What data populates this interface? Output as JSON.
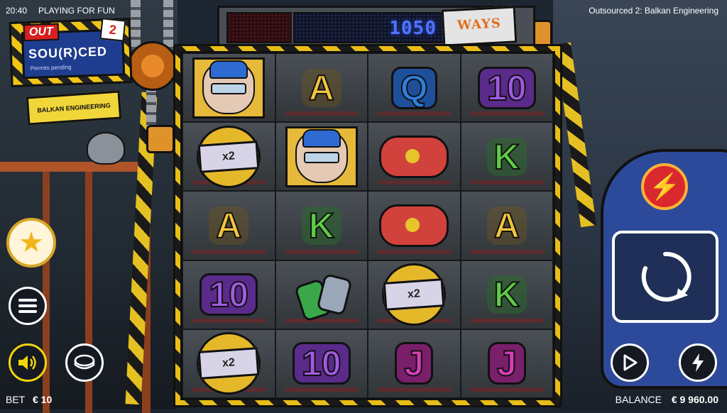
{
  "status_bar": {
    "clock": "20:40",
    "mode": "PLAYING FOR FUN",
    "game_title": "Outsourced 2: Balkan Engineering"
  },
  "logo": {
    "out": "OUT",
    "sourced": "SOU(R)CED",
    "permits": "Permits pending",
    "number": "2",
    "sign": "BALKAN ENGINEERING"
  },
  "win_display": {
    "ways_count": "1050",
    "ways_label": "WAYS"
  },
  "reels": [
    [
      "worker",
      "A",
      "Q",
      "10"
    ],
    [
      "x2",
      "worker",
      "gamepad",
      "K"
    ],
    [
      "A",
      "K",
      "gamepad",
      "A"
    ],
    [
      "10",
      "cans",
      "x2",
      "K"
    ],
    [
      "x2",
      "10",
      "J",
      "J"
    ]
  ],
  "bottom_bar": {
    "bet_label": "BET",
    "bet_value": "€ 10",
    "balance_label": "BALANCE",
    "balance_value": "€ 9 960.00"
  },
  "colors": {
    "stripe_yellow": "#e8bd18",
    "ways_blue": "#4f74ff",
    "bolt_red": "#d9292e",
    "sound_yellow": "#f1d50e"
  },
  "icons": {
    "favorite": "star-icon",
    "menu": "menu-icon",
    "sound": "speaker-icon",
    "bet": "coin-icon",
    "turbo_feature": "lightning-icon",
    "spin": "refresh-icon",
    "autoplay": "play-icon",
    "quick_spin": "lightning-icon"
  }
}
